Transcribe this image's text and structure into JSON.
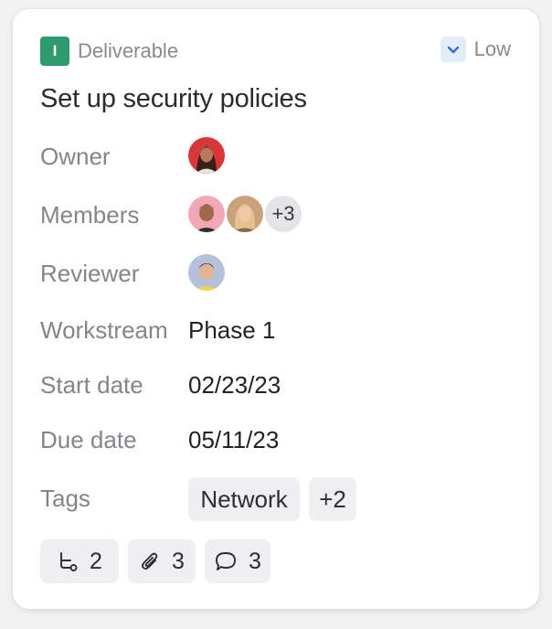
{
  "card": {
    "type_badge": "I",
    "type_label": "Deliverable",
    "priority_label": "Low",
    "title": "Set up security policies"
  },
  "fields": {
    "owner_label": "Owner",
    "members_label": "Members",
    "members_extra": "+3",
    "reviewer_label": "Reviewer",
    "workstream_label": "Workstream",
    "workstream_value": "Phase 1",
    "start_label": "Start date",
    "start_value": "02/23/23",
    "due_label": "Due date",
    "due_value": "05/11/23",
    "tags_label": "Tags",
    "tags": [
      "Network"
    ],
    "tags_extra": "+2"
  },
  "footer": {
    "subtasks_count": "2",
    "attachments_count": "3",
    "comments_count": "3"
  },
  "icons": {
    "type": "deliverable-badge",
    "priority": "chevron-down-icon",
    "subtasks": "subtask-icon",
    "attachments": "paperclip-icon",
    "comments": "comment-icon"
  },
  "colors": {
    "type_badge": "#2e9a6e",
    "priority_bg": "#e3edfa",
    "priority_chevron": "#2f6fd6"
  }
}
